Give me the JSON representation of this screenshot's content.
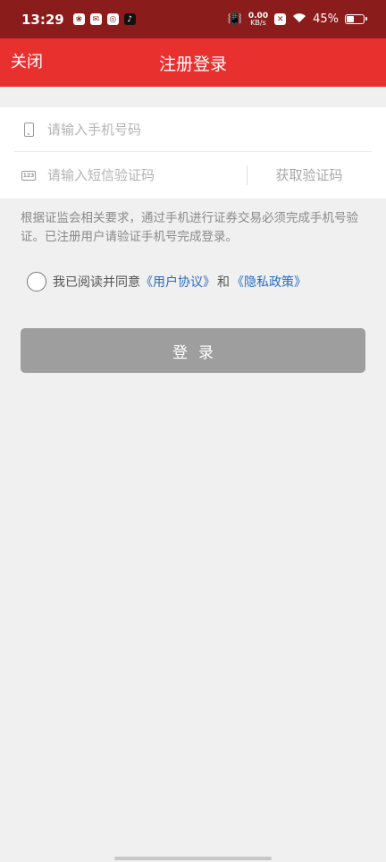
{
  "status_bar": {
    "time": "13:29",
    "net_speed_value": "0.00",
    "net_speed_unit": "KB/s",
    "battery_text": "45%",
    "battery_level": 0.45,
    "left_icons": [
      "baidu-icon",
      "mail-icon",
      "weibo-icon",
      "tiktok-icon"
    ],
    "right_icons": [
      "vibrate-icon",
      "sim-off-icon",
      "wifi-icon",
      "battery-icon"
    ]
  },
  "nav": {
    "close_label": "关闭",
    "title": "注册登录",
    "background_color": "#e8312f"
  },
  "form": {
    "phone_placeholder": "请输入手机号码",
    "sms_placeholder": "请输入短信验证码",
    "get_code_label": "获取验证码",
    "sms_icon_text": "123"
  },
  "notice": "根据证监会相关要求，通过手机进行证券交易必须完成手机号验证。已注册用户请验证手机号完成登录。",
  "agreement": {
    "prefix": "我已阅读并同意",
    "user_agreement": "《用户协议》",
    "conjunction": "和",
    "privacy_policy": "《隐私政策》",
    "link_color": "#2a6dc0"
  },
  "login_button": {
    "label": "登录",
    "color": "#9e9e9e"
  }
}
